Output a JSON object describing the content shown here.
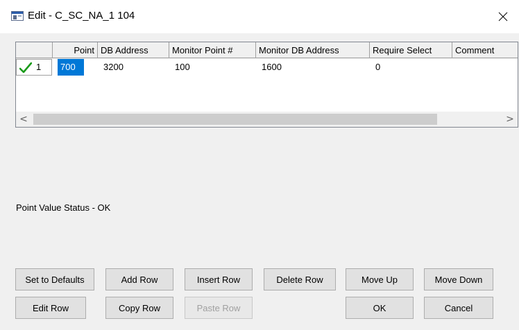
{
  "window": {
    "title": "Edit - C_SC_NA_1 104",
    "close_glyph": "✕"
  },
  "grid": {
    "columns": [
      "",
      "Point",
      "DB Address",
      "Monitor Point #",
      "Monitor DB Address",
      "Require Select",
      "Comment"
    ],
    "rows": [
      {
        "row_number": "1",
        "status_icon": "check-icon",
        "point": "700",
        "db_address": "3200",
        "monitor_point": "100",
        "monitor_db_address": "1600",
        "require_select": "0",
        "comment": ""
      }
    ],
    "scroll_left_glyph": "<",
    "scroll_right_glyph": ">"
  },
  "status_text": "Point Value Status - OK",
  "buttons": {
    "set_to_defaults": "Set to Defaults",
    "add_row": "Add Row",
    "insert_row": "Insert Row",
    "delete_row": "Delete Row",
    "move_up": "Move Up",
    "move_down": "Move Down",
    "edit_row": "Edit Row",
    "copy_row": "Copy Row",
    "paste_row": "Paste Row",
    "ok": "OK",
    "cancel": "Cancel"
  },
  "colors": {
    "selection": "#0078d7",
    "check": "#1a9a1a"
  }
}
